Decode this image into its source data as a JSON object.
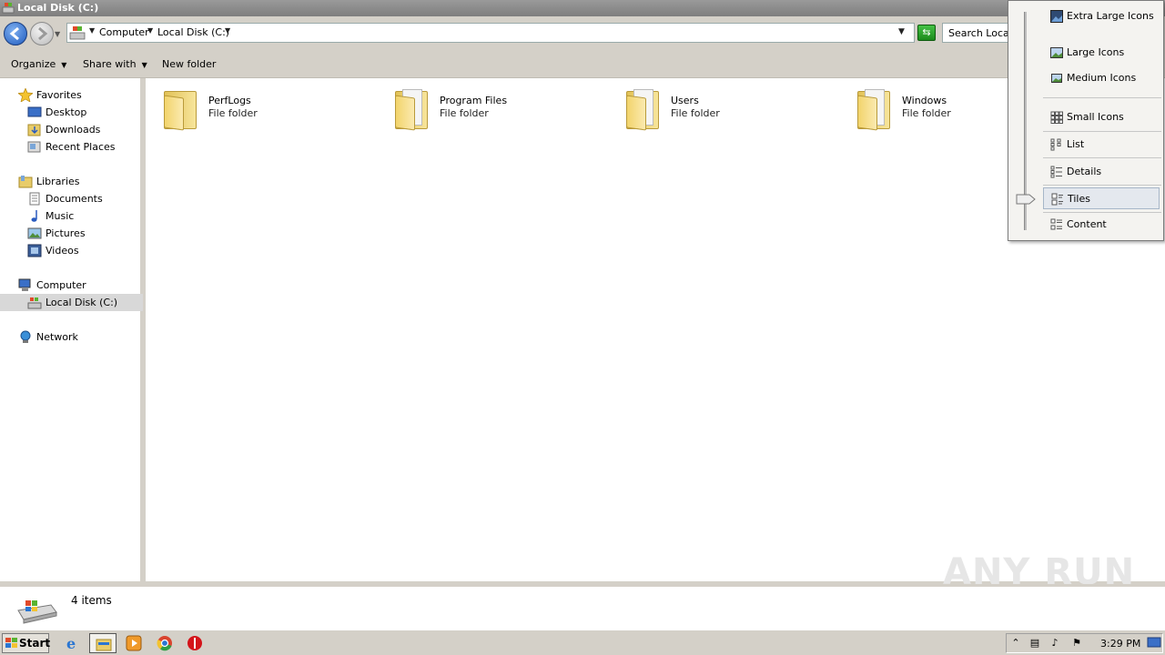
{
  "window": {
    "title": "Local Disk (C:)"
  },
  "address": {
    "crumbs": [
      "Computer",
      "Local Disk (C:)"
    ],
    "search_placeholder": "Search Local D"
  },
  "toolbar": {
    "organize": "Organize",
    "share_with": "Share with",
    "new_folder": "New folder"
  },
  "nav": {
    "favorites": {
      "label": "Favorites",
      "items": [
        "Desktop",
        "Downloads",
        "Recent Places"
      ]
    },
    "libraries": {
      "label": "Libraries",
      "items": [
        "Documents",
        "Music",
        "Pictures",
        "Videos"
      ]
    },
    "computer": {
      "label": "Computer",
      "items": [
        "Local Disk (C:)"
      ]
    },
    "network": {
      "label": "Network"
    }
  },
  "folders": [
    {
      "name": "PerfLogs",
      "type": "File folder"
    },
    {
      "name": "Program Files",
      "type": "File folder"
    },
    {
      "name": "Users",
      "type": "File folder"
    },
    {
      "name": "Windows",
      "type": "File folder"
    }
  ],
  "status": {
    "items_count": "4 items"
  },
  "view_menu": {
    "items": [
      "Extra Large Icons",
      "Large Icons",
      "Medium Icons",
      "Small Icons",
      "List",
      "Details",
      "Tiles",
      "Content"
    ],
    "selected": "Tiles"
  },
  "taskbar": {
    "start": "Start",
    "clock": "3:29 PM"
  },
  "watermark": "ANY RUN",
  "colors": {
    "accent": "#1f5bbf",
    "selection": "#d8d8d8",
    "folder": "#f2d46c"
  }
}
